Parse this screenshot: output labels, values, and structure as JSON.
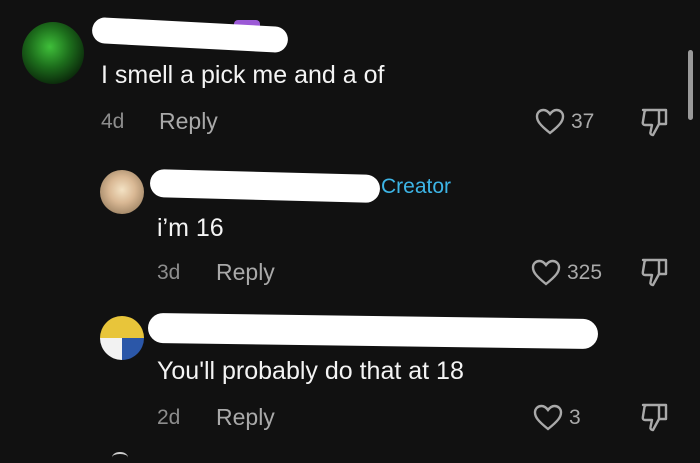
{
  "comments": [
    {
      "text": "I smell a pick me and a of",
      "age": "4d",
      "reply_label": "Reply",
      "likes": "37"
    },
    {
      "text": "i’m 16",
      "badge": "Creator",
      "age": "3d",
      "reply_label": "Reply",
      "likes": "325"
    },
    {
      "text": "You'll probably do that at 18",
      "age": "2d",
      "reply_label": "Reply",
      "likes": "3"
    }
  ],
  "colors": {
    "background": "#111111",
    "creator_badge": "#3db5e6",
    "muted": "#a9a9a9"
  }
}
